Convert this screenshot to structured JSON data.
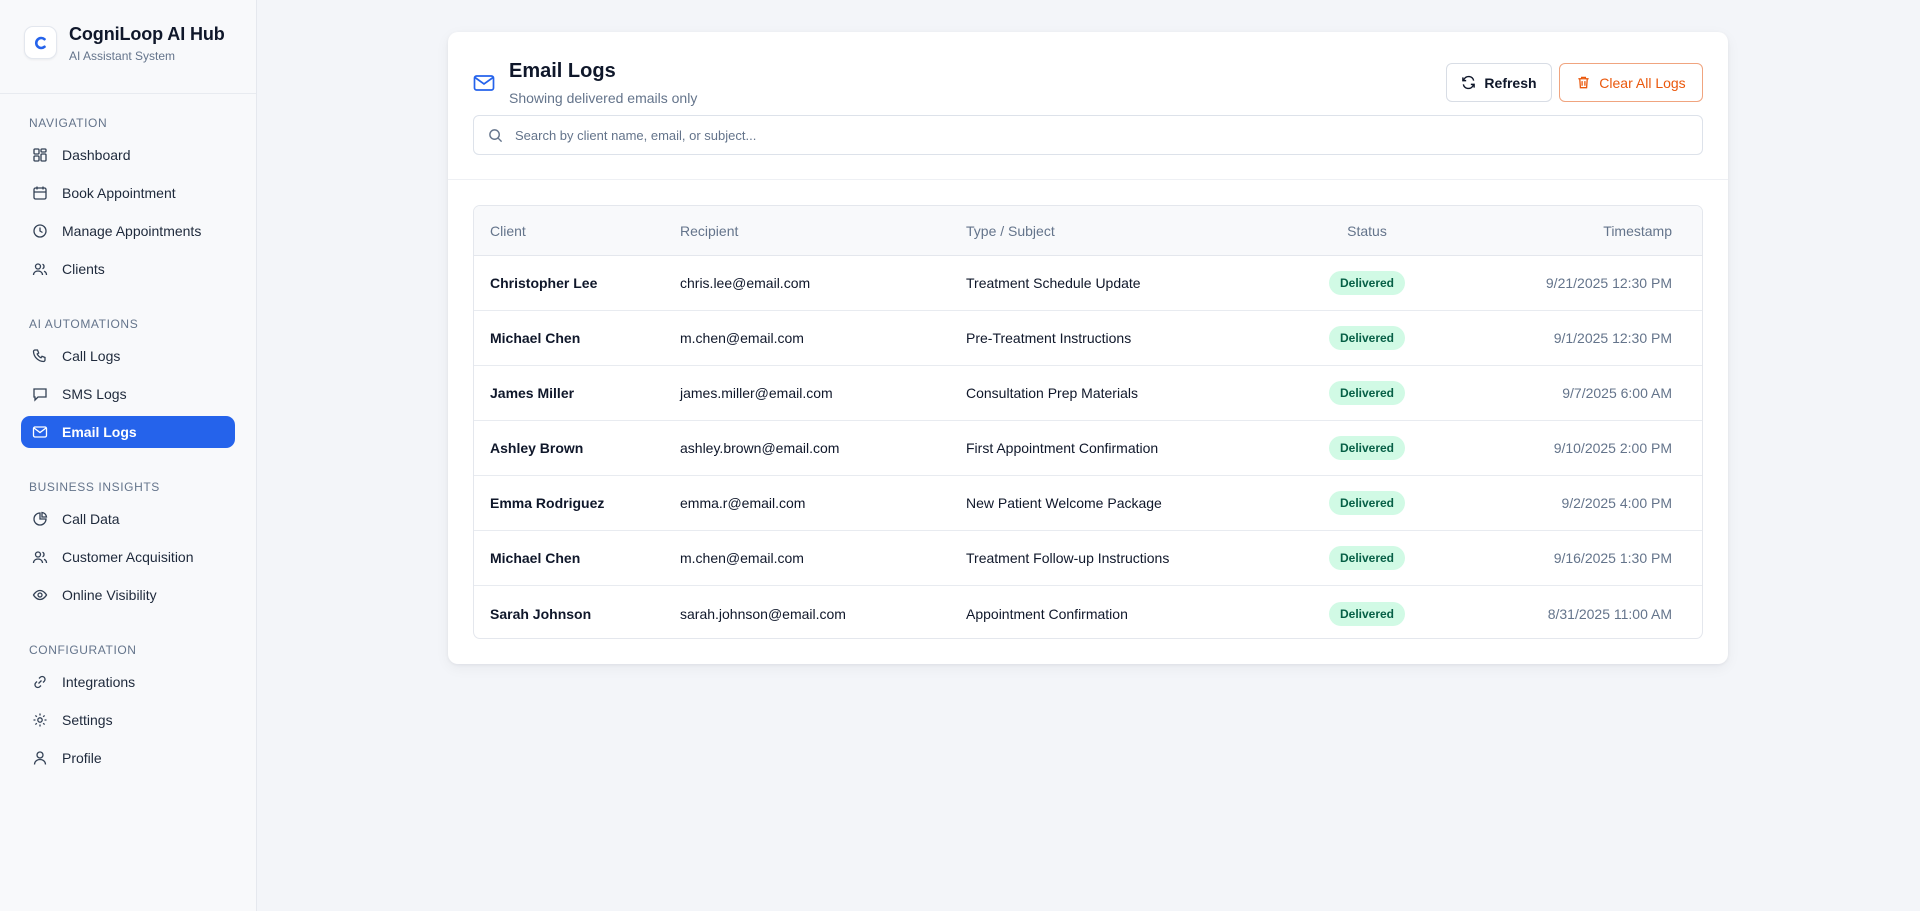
{
  "brand": {
    "title": "CogniLoop AI Hub",
    "subtitle": "AI Assistant System"
  },
  "sidebar": {
    "sections": [
      {
        "heading": "NAVIGATION",
        "items": [
          {
            "label": "Dashboard",
            "icon": "dashboard-icon"
          },
          {
            "label": "Book Appointment",
            "icon": "calendar-icon"
          },
          {
            "label": "Manage Appointments",
            "icon": "clock-icon"
          },
          {
            "label": "Clients",
            "icon": "users-icon"
          }
        ]
      },
      {
        "heading": "AI AUTOMATIONS",
        "items": [
          {
            "label": "Call Logs",
            "icon": "phone-icon"
          },
          {
            "label": "SMS Logs",
            "icon": "message-icon"
          },
          {
            "label": "Email Logs",
            "icon": "mail-icon",
            "active": true
          }
        ]
      },
      {
        "heading": "BUSINESS INSIGHTS",
        "items": [
          {
            "label": "Call Data",
            "icon": "pie-chart-icon"
          },
          {
            "label": "Customer Acquisition",
            "icon": "users-icon"
          },
          {
            "label": "Online Visibility",
            "icon": "eye-icon"
          }
        ]
      },
      {
        "heading": "CONFIGURATION",
        "items": [
          {
            "label": "Integrations",
            "icon": "link-icon"
          },
          {
            "label": "Settings",
            "icon": "gear-icon"
          },
          {
            "label": "Profile",
            "icon": "user-icon"
          }
        ]
      }
    ]
  },
  "header": {
    "title": "Email Logs",
    "subtitle": "Showing delivered emails only",
    "refresh_label": "Refresh",
    "clear_label": "Clear All Logs"
  },
  "search": {
    "placeholder": "Search by client name, email, or subject...",
    "value": ""
  },
  "table": {
    "columns": [
      "Client",
      "Recipient",
      "Type / Subject",
      "Status",
      "Timestamp"
    ],
    "rows": [
      {
        "client": "Christopher Lee",
        "recipient": "chris.lee@email.com",
        "subject": "Treatment Schedule Update",
        "status": "Delivered",
        "timestamp": "9/21/2025 12:30 PM"
      },
      {
        "client": "Michael Chen",
        "recipient": "m.chen@email.com",
        "subject": "Pre-Treatment Instructions",
        "status": "Delivered",
        "timestamp": "9/1/2025 12:30 PM"
      },
      {
        "client": "James Miller",
        "recipient": "james.miller@email.com",
        "subject": "Consultation Prep Materials",
        "status": "Delivered",
        "timestamp": "9/7/2025 6:00 AM"
      },
      {
        "client": "Ashley Brown",
        "recipient": "ashley.brown@email.com",
        "subject": "First Appointment Confirmation",
        "status": "Delivered",
        "timestamp": "9/10/2025 2:00 PM"
      },
      {
        "client": "Emma Rodriguez",
        "recipient": "emma.r@email.com",
        "subject": "New Patient Welcome Package",
        "status": "Delivered",
        "timestamp": "9/2/2025 4:00 PM"
      },
      {
        "client": "Michael Chen",
        "recipient": "m.chen@email.com",
        "subject": "Treatment Follow-up Instructions",
        "status": "Delivered",
        "timestamp": "9/16/2025 1:30 PM"
      },
      {
        "client": "Sarah Johnson",
        "recipient": "sarah.johnson@email.com",
        "subject": "Appointment Confirmation",
        "status": "Delivered",
        "timestamp": "8/31/2025 11:00 AM"
      }
    ]
  },
  "colors": {
    "accent": "#2563eb",
    "danger": "#ea580c",
    "success_bg": "#d1fae5",
    "success_text": "#065f46"
  }
}
